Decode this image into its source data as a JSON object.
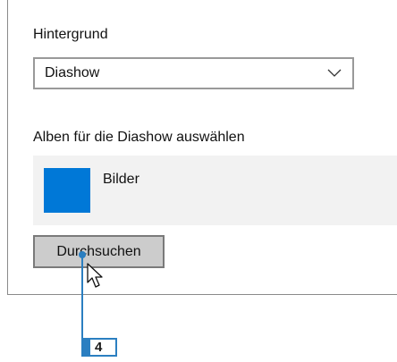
{
  "background_section": {
    "label": "Hintergrund",
    "dropdown_value": "Diashow"
  },
  "albums_section": {
    "label": "Alben für die Diashow auswählen",
    "albums": [
      {
        "name": "Bilder",
        "thumbnail_color": "#0078d7"
      }
    ]
  },
  "browse_button": {
    "label": "Durchsuchen"
  },
  "callout": {
    "step": "4",
    "color": "#2b7fc1"
  },
  "icons": {
    "dropdown": "chevron-down-icon",
    "cursor": "mouse-pointer-icon"
  }
}
